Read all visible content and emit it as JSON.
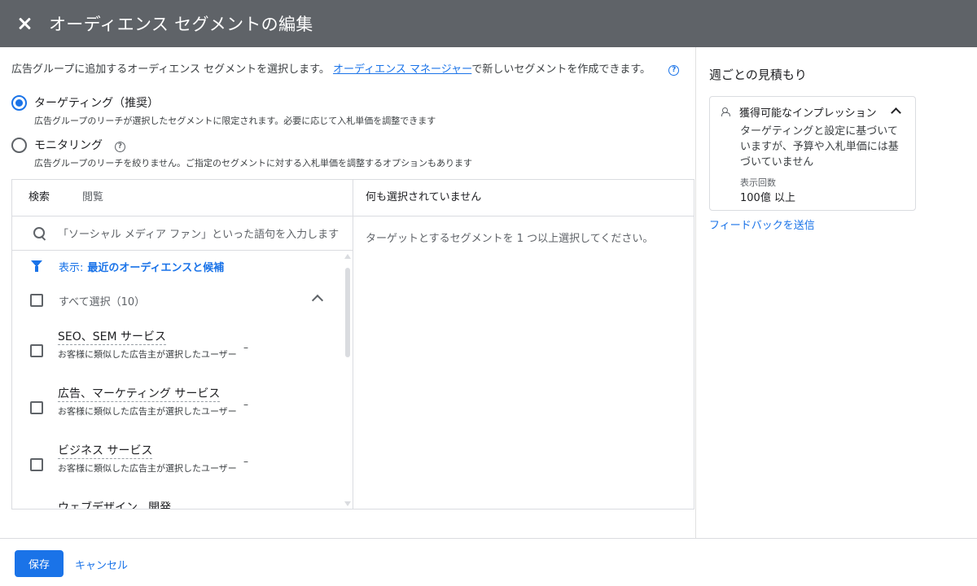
{
  "header": {
    "title": "オーディエンス セグメントの編集",
    "close_icon": "close-icon"
  },
  "intro": {
    "text_before": "広告グループに追加するオーディエンス セグメントを選択します。",
    "link": "オーディエンス マネージャー",
    "text_after": "で新しいセグメントを作成できます。",
    "help_icon": "?"
  },
  "targeting_options": [
    {
      "label": "ターゲティング（推奨）",
      "description": "広告グループのリーチが選択したセグメントに限定されます。必要に応じて入札単価を調整できます",
      "selected": true
    },
    {
      "label": "モニタリング",
      "help_icon": "?",
      "description": "広告グループのリーチを絞りません。ご指定のセグメントに対する入札単価を調整するオプションもあります",
      "selected": false
    }
  ],
  "tabs": [
    "検索",
    "閲覧"
  ],
  "search": {
    "placeholder": "「ソーシャル メディア ファン」といった語句を入力します"
  },
  "filter": {
    "prefix": "表示:",
    "value": "最近のオーディエンスと候補"
  },
  "select_all": "すべて選択（10）",
  "segments": [
    {
      "name": "SEO、SEM サービス",
      "desc": "お客様に類似した広告主が選択したユーザー",
      "metric": "–"
    },
    {
      "name": "広告、マーケティング サービス",
      "desc": "お客様に類似した広告主が選択したユーザー",
      "metric": "–"
    },
    {
      "name": "ビジネス サービス",
      "desc": "お客様に類似した広告主が選択したユーザー",
      "metric": "–"
    },
    {
      "name": "ウェブデザイン、開発",
      "desc": "",
      "metric": ""
    }
  ],
  "selected_panel": {
    "heading": "何も選択されていません",
    "message": "ターゲットとするセグメントを 1 つ以上選択してください。"
  },
  "estimates": {
    "title": "週ごとの見積もり",
    "card_title": "獲得可能なインプレッション",
    "card_desc": "ターゲティングと設定に基づいていますが、予算や入札単価には基づいていません",
    "stat_label": "表示回数",
    "stat_value": "100億 以上",
    "feedback": "フィードバックを送信"
  },
  "footer": {
    "save": "保存",
    "cancel": "キャンセル"
  },
  "colors": {
    "header_bg": "#5f6368",
    "accent": "#1a73e8"
  }
}
